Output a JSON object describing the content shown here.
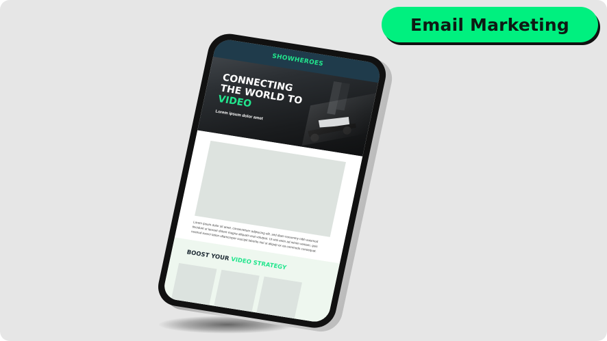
{
  "badge": {
    "label": "Email Marketing"
  },
  "tablet": {
    "brand": "SHOWHEROES",
    "headline": {
      "line1": "CONNECTING",
      "line2": "THE WORLD TO",
      "line3": "VIDEO"
    },
    "subheadline": "Lorem ipsum dolor amet",
    "body_text": "Lorem ipsum dolor sit amet, consectetuer adipiscing elit, sed diam nonummy nibh euismod tincidunt ut laoreet dolore magna aliquam erat volutpat. Ut wisi enim ad minim veniam, quis nostrud exerci tation ullamcorper suscipit lobortis nisl ut aliquip ex ea commodo consequat.",
    "section_title": {
      "part1": "BOOST YOUR ",
      "part2": "VIDEO STRATEGY"
    }
  },
  "colors": {
    "accent": "#00f07f",
    "brand_bar": "#1f3b4b",
    "brand_green": "#22e58d"
  }
}
